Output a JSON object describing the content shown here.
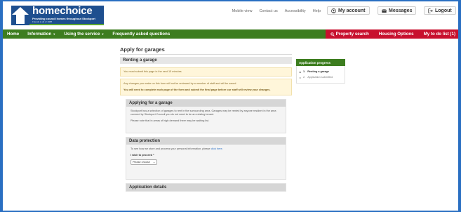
{
  "brand": {
    "name": "homechoice",
    "tagline": "Providing council homes throughout Stockport",
    "subline": "Friends to all of 1988"
  },
  "top_links": [
    "Mobile view",
    "Contact us",
    "Accessibility",
    "Help"
  ],
  "account": {
    "my_account": "My account",
    "messages": "Messages",
    "logout": "Logout"
  },
  "nav": {
    "home": "Home",
    "information": "Information",
    "using_service": "Using the service",
    "faq": "Frequently asked questions",
    "property_search": "Property search",
    "housing_options": "Housing Options",
    "todo": "My to do list (1)"
  },
  "page": {
    "title": "Apply for garages",
    "section_title": "Renting a garage",
    "time_notice": "You must submit this page in the next 15 minutes",
    "notice_1": "Any changes you make on this form will not be reviewed by a member of staff and will be saved.",
    "notice_2": "You will need to complete each page of the form and submit the final page before our staff will review your changes."
  },
  "cards": {
    "applying_title": "Applying for a garage",
    "applying_p1": "Stockport has a selection of garages to rent in the surrounding area. Garages may be rented by anyone resident in the area covered by Stockport Council you do not need to be an existing tenant.",
    "applying_p2": "Please note that in areas of high demand there may be waiting list.",
    "data_title": "Data protection",
    "data_text": "To see how we store and process your personal information, please",
    "data_link": "click here.",
    "proceed_label": "I wish to proceed *",
    "proceed_value": "Please choose",
    "details_title": "Application details"
  },
  "progress": {
    "title": "Application progress",
    "steps": [
      {
        "num": "1.",
        "label": "Renting a garage"
      },
      {
        "num": "2.",
        "label": "Application submitted"
      }
    ]
  },
  "colors": {
    "frame_blue": "#2a6fc2",
    "brand_blue": "#1e4f8f",
    "nav_green": "#3d7d1f",
    "nav_red": "#c8102e",
    "notice_bg": "#fff6da"
  }
}
